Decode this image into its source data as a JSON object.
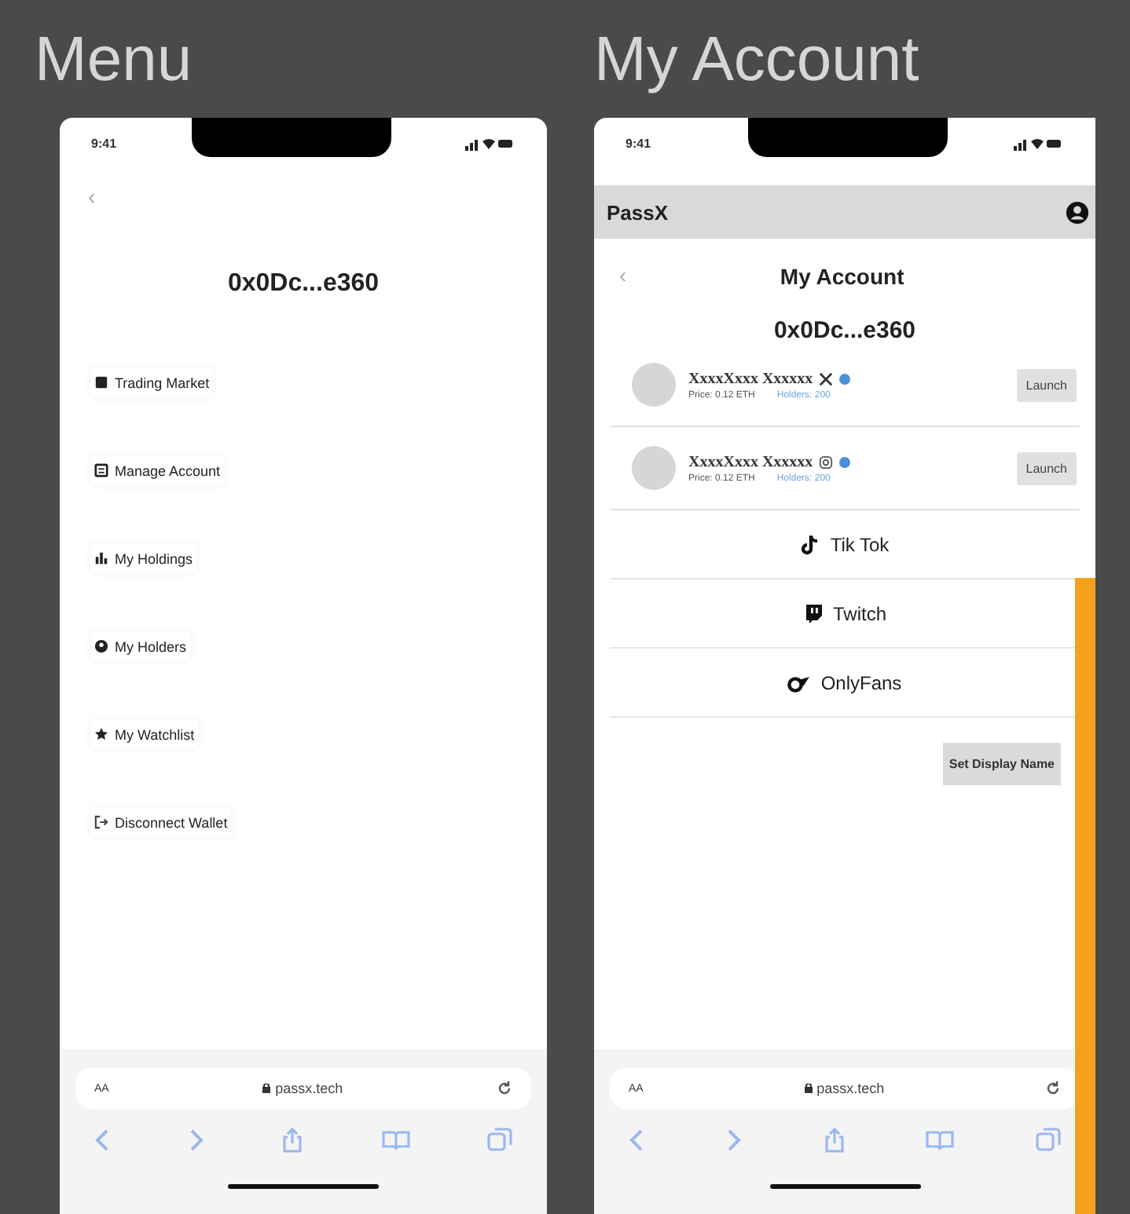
{
  "menu_frame": {
    "title": "Menu",
    "status_time": "9:41",
    "back": "‹",
    "address": "0x0Dc...e360",
    "items": [
      {
        "label": "Trading Market"
      },
      {
        "label": "Manage Account"
      },
      {
        "label": "My Holdings"
      },
      {
        "label": "My Holders"
      },
      {
        "label": "My Watchlist"
      },
      {
        "label": "Disconnect Wallet"
      }
    ],
    "browser": {
      "text_size": "AA",
      "url": "passx.tech"
    }
  },
  "account_frame": {
    "title": "My Account",
    "status_time": "9:41",
    "brand": "PassX",
    "back": "‹",
    "heading": "My Account",
    "address": "0x0Dc...e360",
    "accounts": [
      {
        "name": "XxxxXxxx Xxxxxx",
        "kind": "x",
        "verified": true,
        "price": "Price: 0.12 ETH",
        "holders": "Holders: 200",
        "button": "Launch"
      },
      {
        "name": "XxxxXxxx Xxxxxx",
        "kind": "instagram",
        "verified": true,
        "price": "Price: 0.12 ETH",
        "holders": "Holders: 200",
        "button": "Launch"
      }
    ],
    "socials": [
      {
        "label": "Tik Tok",
        "kind": "tiktok"
      },
      {
        "label": "Twitch",
        "kind": "twitch"
      },
      {
        "label": "OnlyFans",
        "kind": "onlyfans"
      }
    ],
    "set_name_button": "Set Display Name",
    "browser": {
      "text_size": "AA",
      "url": "passx.tech"
    }
  }
}
